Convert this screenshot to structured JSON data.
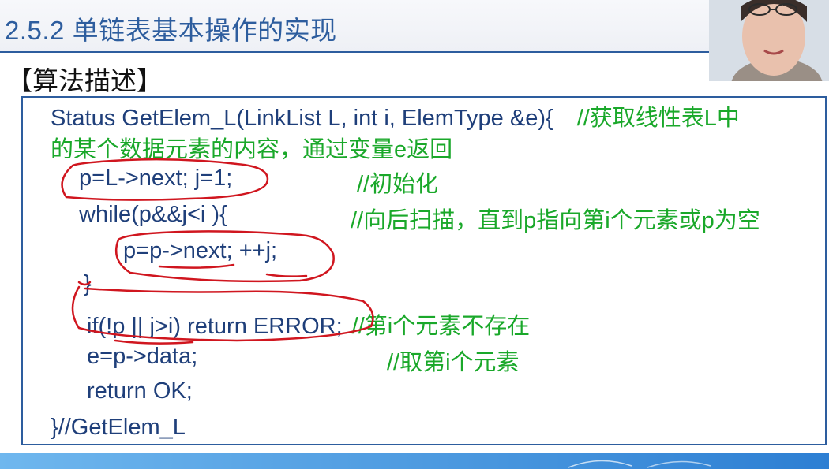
{
  "slide": {
    "title": "2.5.2 单链表基本操作的实现",
    "section_label": "【算法描述】"
  },
  "code": {
    "line1": {
      "code": "Status GetElem_L(LinkList L, int i, ElemType &e){",
      "comment": "//获取线性表L中"
    },
    "line2": {
      "comment": "的某个数据元素的内容，通过变量e返回"
    },
    "line3": {
      "code": "p=L->next; j=1;",
      "comment": "//初始化"
    },
    "line4": {
      "code": "while(p&&j<i ){",
      "comment": "//向后扫描，直到p指向第i个元素或p为空"
    },
    "line5": {
      "code": "p=p->next; ++j;"
    },
    "line6": {
      "code": "}"
    },
    "line7": {
      "code": "if(!p || j>i)  return ERROR;",
      "comment": "//第i个元素不存在"
    },
    "line8": {
      "code": "e=p->data;",
      "comment": "//取第i个元素"
    },
    "line9": {
      "code": "return OK;"
    },
    "line10": {
      "code": "}//GetElem_L"
    }
  },
  "colors": {
    "title": "#2d5d9e",
    "code": "#1f3f7a",
    "comment": "#1aa82a",
    "annotation": "#d0161f",
    "footer": "#2d7fd3"
  }
}
